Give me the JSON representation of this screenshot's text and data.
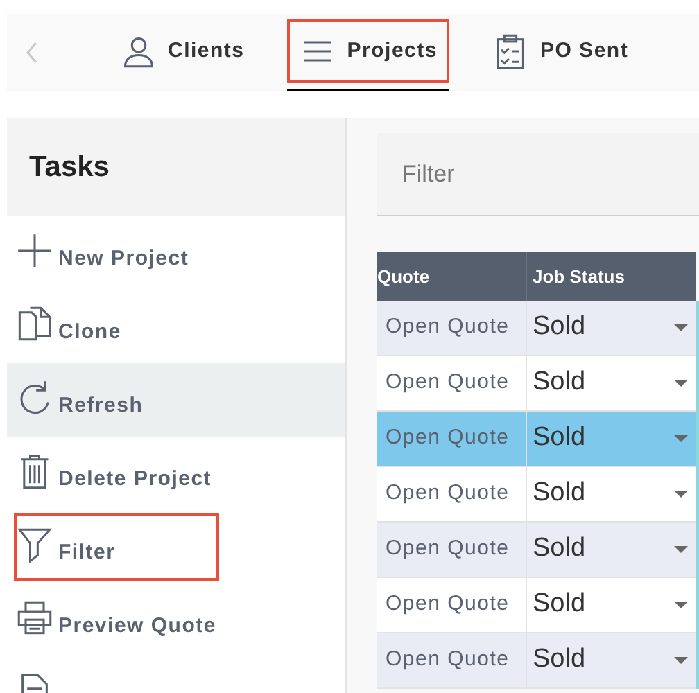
{
  "tabs": [
    {
      "label": "Clients",
      "kind": "person",
      "selected": false,
      "highlighted": false
    },
    {
      "label": "Projects",
      "kind": "menu",
      "selected": true,
      "highlighted": true
    },
    {
      "label": "PO Sent",
      "kind": "clipboard",
      "selected": false,
      "highlighted": false
    }
  ],
  "sidebar": {
    "title": "Tasks",
    "items": [
      {
        "label": "New Project",
        "kind": "plus",
        "hovered": false,
        "highlighted": false
      },
      {
        "label": "Clone",
        "kind": "copy",
        "hovered": false,
        "highlighted": false
      },
      {
        "label": "Refresh",
        "kind": "refresh",
        "hovered": true,
        "highlighted": false
      },
      {
        "label": "Delete Project",
        "kind": "trash",
        "hovered": false,
        "highlighted": false
      },
      {
        "label": "Filter",
        "kind": "filter",
        "hovered": false,
        "highlighted": true
      },
      {
        "label": "Preview Quote",
        "kind": "printer",
        "hovered": false,
        "highlighted": false
      },
      {
        "kind": "document",
        "hovered": false,
        "highlighted": false
      }
    ]
  },
  "filter": {
    "placeholder": "Filter"
  },
  "table": {
    "columns": [
      "Quote",
      "Job Status"
    ],
    "rows": [
      {
        "quote": "Open Quote",
        "status": "Sold",
        "selected": false
      },
      {
        "quote": "Open Quote",
        "status": "Sold",
        "selected": false
      },
      {
        "quote": "Open Quote",
        "status": "Sold",
        "selected": true
      },
      {
        "quote": "Open Quote",
        "status": "Sold",
        "selected": false
      },
      {
        "quote": "Open Quote",
        "status": "Sold",
        "selected": false
      },
      {
        "quote": "Open Quote",
        "status": "Sold",
        "selected": false
      },
      {
        "quote": "Open Quote",
        "status": "Sold",
        "selected": false
      }
    ]
  }
}
